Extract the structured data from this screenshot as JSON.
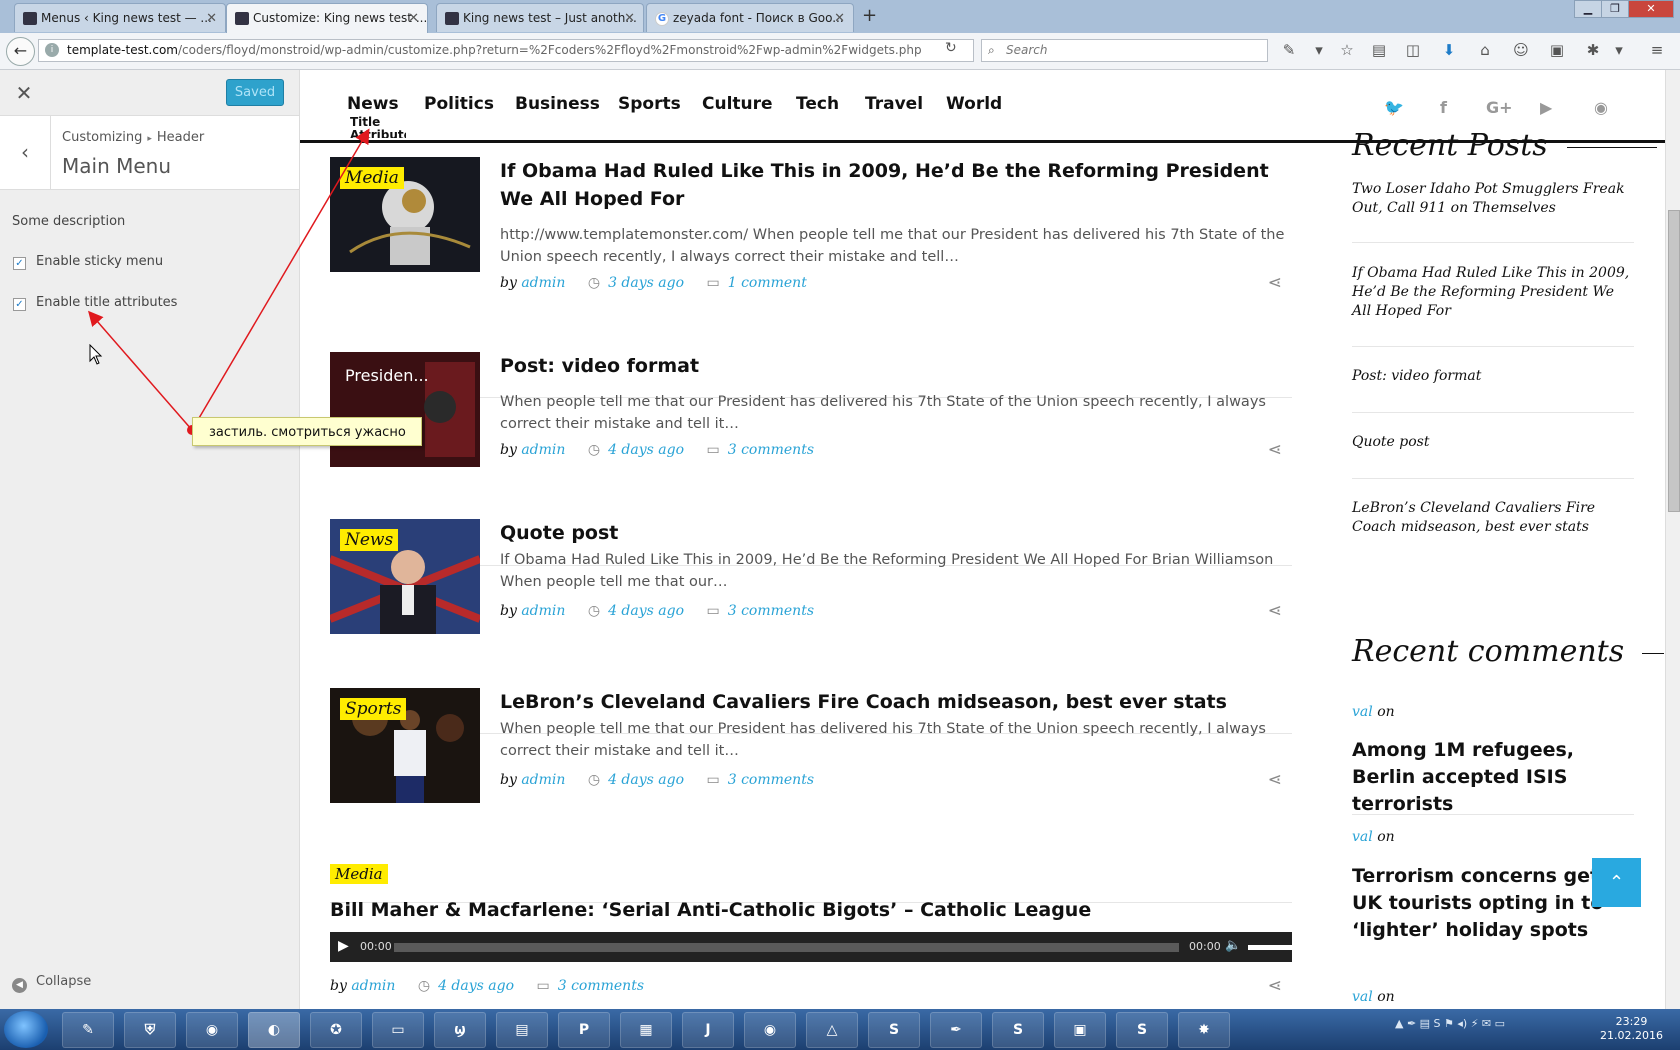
{
  "browser": {
    "tabs": [
      {
        "label": "Menus ‹ King news test — ...",
        "active": false
      },
      {
        "label": "Customize: King news test ...",
        "active": true
      },
      {
        "label": "King news test – Just anoth...",
        "active": false
      },
      {
        "label": "zeyada font - Поиск в Goo...",
        "active": false
      }
    ],
    "url_host": "template-test.com",
    "url_rest": "/coders/floyd/monstroid/wp-admin/customize.php?return=%2Fcoders%2Ffloyd%2Fmonstroid%2Fwp-admin%2Fwidgets.php",
    "search_placeholder": "Search",
    "toolbar_icons": [
      "screenshot-icon",
      "star-icon",
      "reading-list-icon",
      "pocket-icon",
      "download-icon",
      "home-icon",
      "chat-icon",
      "extension-icon",
      "addon-icon",
      "menu-icon"
    ]
  },
  "customizer": {
    "saved_label": "Saved",
    "breadcrumb": [
      "Customizing",
      "Header"
    ],
    "section_title": "Main Menu",
    "description": "Some description",
    "checkboxes": [
      {
        "label": "Enable sticky menu",
        "checked": true
      },
      {
        "label": "Enable title attributes",
        "checked": true
      }
    ],
    "collapse_label": "Collapse"
  },
  "site": {
    "nav": [
      "News",
      "Politics",
      "Business",
      "Sports",
      "Culture",
      "Tech",
      "Travel",
      "World"
    ],
    "title_attribute_tooltip": "Title Attribute",
    "social": [
      "twitter-icon",
      "facebook-icon",
      "google-plus-icon",
      "youtube-icon",
      "rss-icon"
    ],
    "posts": [
      {
        "category": "Media",
        "title": "If Obama Had Ruled Like This in 2009, He’d Be the Reforming President We All Hoped For",
        "excerpt": "http://www.templatemonster.com/ When people tell me that our President has delivered his 7th State of the Union speech recently, I always correct their mistake and tell…",
        "author": "admin",
        "date": "3 days ago",
        "comments": "1 comment"
      },
      {
        "category": "",
        "thumb_text": "Presiden...",
        "title": "Post: video format",
        "excerpt": "When people tell me that our President has delivered his 7th State of the Union speech recently, I always correct their mistake and tell it…",
        "author": "admin",
        "date": "4 days ago",
        "comments": "3 comments"
      },
      {
        "category": "News",
        "title": "Quote post",
        "excerpt": "If Obama Had Ruled Like This in 2009, He’d Be the Reforming President We All Hoped For Brian Williamson When people tell me that our…",
        "author": "admin",
        "date": "4 days ago",
        "comments": "3 comments"
      },
      {
        "category": "Sports",
        "title": "LeBron’s Cleveland Cavaliers Fire Coach midseason, best ever stats",
        "excerpt": "When people tell me that our President has delivered his 7th State of the Union speech recently, I always correct their mistake and tell it…",
        "author": "admin",
        "date": "4 days ago",
        "comments": "3 comments"
      },
      {
        "category": "Media",
        "title": "Bill Maher & Macfarlene: ‘Serial Anti-Catholic Bigots’ – Catholic League",
        "author": "admin",
        "date": "4 days ago",
        "comments": "3 comments"
      }
    ],
    "by_label": "by",
    "audio": {
      "current": "00:00",
      "duration": "00:00"
    },
    "sidebar": {
      "recent_posts_title": "Recent Posts",
      "recent_posts": [
        "Two Loser Idaho Pot Smugglers Freak Out, Call 911 on Themselves",
        "If Obama Had Ruled Like This in 2009, He’d Be the Reforming President We All Hoped For",
        "Post: video format",
        "Quote post",
        "LeBron’s Cleveland Cavaliers Fire Coach midseason, best ever stats"
      ],
      "recent_comments_title": "Recent comments",
      "on_label": "on",
      "recent_comments": [
        {
          "author": "val",
          "post": "Among 1M refugees, Berlin accepted ISIS terrorists"
        },
        {
          "author": "val",
          "post": "Terrorism concerns get UK tourists opting in to ‘lighter’ holiday spots"
        },
        {
          "author": "val",
          "post": ""
        }
      ]
    }
  },
  "annotation": {
    "note": "застиль. смотриться ужасно",
    "color": "#e0191e"
  },
  "taskbar": {
    "time": "23:29",
    "date": "21.02.2016"
  },
  "colors": {
    "accent": "#2aa3d6",
    "badge": "#ffec00",
    "saved": "#2ea2cc"
  }
}
